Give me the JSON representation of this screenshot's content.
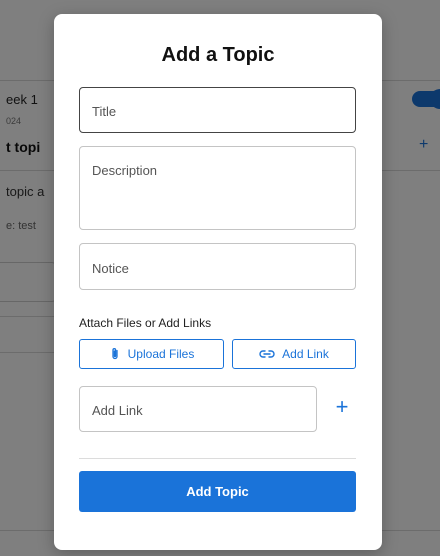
{
  "background": {
    "week_label": "eek 1",
    "date_label": "024",
    "topic_title": "t topi",
    "topic_desc": "topic a",
    "topic_notice": "e: test"
  },
  "modal": {
    "title": "Add a Topic",
    "fields": {
      "title_placeholder": "Title",
      "description_placeholder": "Description",
      "notice_placeholder": "Notice",
      "add_link_placeholder": "Add Link"
    },
    "attach_label": "Attach Files or Add Links",
    "upload_button": "Upload Files",
    "add_link_button": "Add Link",
    "add_link_plus": "+",
    "submit_button": "Add Topic"
  },
  "colors": {
    "accent": "#1a73d9",
    "overlay": "rgba(0,0,0,0.5)"
  },
  "icons": {
    "upload": "paperclip-icon",
    "link": "link-icon",
    "add": "plus-icon"
  }
}
